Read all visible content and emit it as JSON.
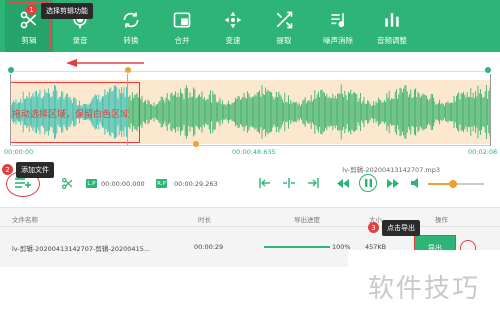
{
  "toolbar": {
    "items": [
      {
        "label": "剪辑",
        "icon": "scissors-icon"
      },
      {
        "label": "录音",
        "icon": "microphone-icon"
      },
      {
        "label": "转换",
        "icon": "convert-icon"
      },
      {
        "label": "合并",
        "icon": "merge-icon"
      },
      {
        "label": "变速",
        "icon": "speed-icon"
      },
      {
        "label": "提取",
        "icon": "extract-icon"
      },
      {
        "label": "噪声消除",
        "icon": "noise-icon"
      },
      {
        "label": "音频调整",
        "icon": "equalizer-icon"
      }
    ]
  },
  "annotations": {
    "step1_badge": "1",
    "step1_tip": "选择剪辑功能",
    "step2_badge": "2",
    "step2_tip": "添加文件",
    "step3_badge": "3",
    "step3_tip": "点击导出",
    "wave_label": "拖动选择区域，保留白色区域"
  },
  "waveform": {
    "time_start": "00:00:00",
    "time_mid": "00:00:48.635",
    "time_end": "00:02:08"
  },
  "controls": {
    "file_name": "lv-剪辑-20200413142707.mp3",
    "start_pill": "L.P",
    "start_time": "00:00:00.000",
    "end_pill": "R.P",
    "end_time": "00:00:29.263",
    "volume_level": 0.45
  },
  "table": {
    "headers": {
      "name": "文件名称",
      "duration": "时长",
      "progress": "导出进度",
      "size": "大小",
      "action": "操作"
    },
    "row": {
      "name": "lv-剪辑-20200413142707-剪辑-20200415...",
      "duration": "00:00:29",
      "progress_pct": "100%",
      "size": "457KB",
      "export_label": "导出"
    }
  },
  "watermark": "软件技巧",
  "colors": {
    "accent": "#2db476",
    "annotation": "#e04040",
    "selection_bg": "#fbe8cf"
  }
}
